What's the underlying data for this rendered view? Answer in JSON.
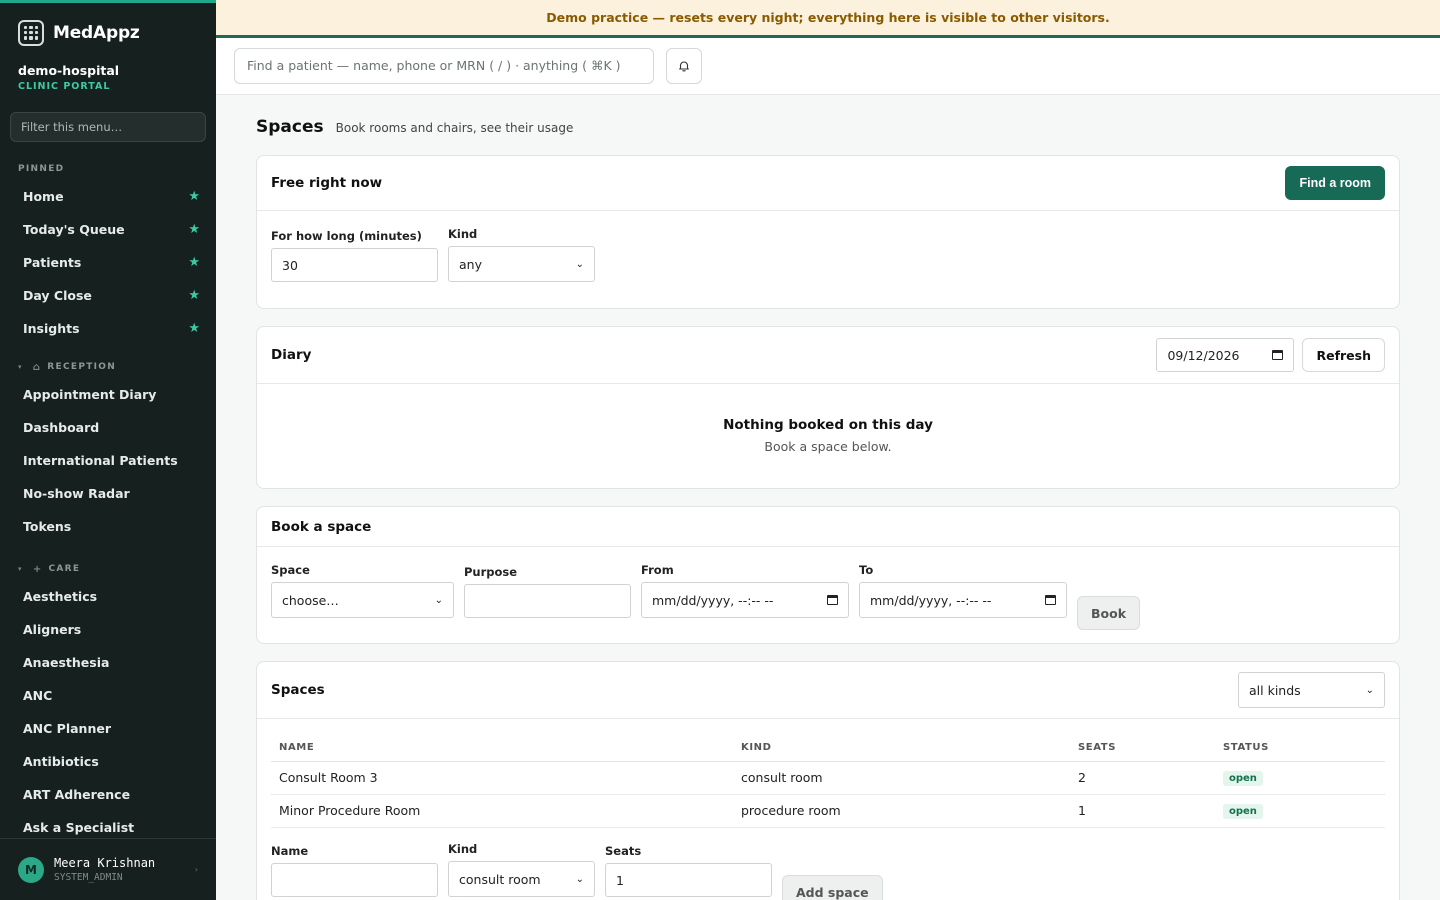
{
  "brand": {
    "name": "MedAppz"
  },
  "org": {
    "name": "demo-hospital",
    "subtitle": "CLINIC PORTAL"
  },
  "sidebar": {
    "filter_placeholder": "Filter this menu…",
    "pinned_label": "PINNED",
    "pinned": [
      {
        "label": "Home"
      },
      {
        "label": "Today's Queue"
      },
      {
        "label": "Patients"
      },
      {
        "label": "Day Close"
      },
      {
        "label": "Insights"
      }
    ],
    "groups": [
      {
        "label": "RECEPTION",
        "icon": "house-icon",
        "items": [
          {
            "label": "Appointment Diary"
          },
          {
            "label": "Dashboard"
          },
          {
            "label": "International Patients"
          },
          {
            "label": "No-show Radar"
          },
          {
            "label": "Tokens"
          }
        ]
      },
      {
        "label": "CARE",
        "icon": "plus-icon",
        "items": [
          {
            "label": "Aesthetics"
          },
          {
            "label": "Aligners"
          },
          {
            "label": "Anaesthesia"
          },
          {
            "label": "ANC"
          },
          {
            "label": "ANC Planner"
          },
          {
            "label": "Antibiotics"
          },
          {
            "label": "ART Adherence"
          },
          {
            "label": "Ask a Specialist"
          }
        ]
      }
    ]
  },
  "user": {
    "initial": "M",
    "name": "Meera Krishnan",
    "role": "SYSTEM_ADMIN"
  },
  "banner": {
    "text": "Demo practice — resets every night; everything here is visible to other visitors."
  },
  "topbar": {
    "search_placeholder": "Find a patient — name, phone or MRN ( / ) · anything ( ⌘K )"
  },
  "page": {
    "title": "Spaces",
    "subtitle": "Book rooms and chairs, see their usage"
  },
  "free_now": {
    "title": "Free right now",
    "button": "Find a room",
    "duration_label": "For how long (minutes)",
    "duration_value": "30",
    "kind_label": "Kind",
    "kind_value": "any"
  },
  "diary": {
    "title": "Diary",
    "date_value": "09/12/2026",
    "refresh_button": "Refresh",
    "empty_title": "Nothing booked on this day",
    "empty_sub": "Book a space below."
  },
  "book": {
    "title": "Book a space",
    "space_label": "Space",
    "space_value": "choose…",
    "purpose_label": "Purpose",
    "purpose_value": "",
    "from_label": "From",
    "from_value": "mm/dd/yyyy, --:-- --",
    "to_label": "To",
    "to_value": "mm/dd/yyyy, --:-- --",
    "button": "Book"
  },
  "spaces": {
    "title": "Spaces",
    "filter_value": "all kinds",
    "columns": [
      "NAME",
      "KIND",
      "SEATS",
      "STATUS"
    ],
    "rows": [
      {
        "name": "Consult Room 3",
        "kind": "consult room",
        "seats": "2",
        "status": "open"
      },
      {
        "name": "Minor Procedure Room",
        "kind": "procedure room",
        "seats": "1",
        "status": "open"
      }
    ],
    "add": {
      "name_label": "Name",
      "name_value": "",
      "kind_label": "Kind",
      "kind_value": "consult room",
      "seats_label": "Seats",
      "seats_value": "1",
      "button": "Add space"
    }
  },
  "colors": {
    "accent": "#166a56",
    "sidebar_bg": "#16201f",
    "star": "#3ec9a4",
    "banner_bg": "#fbf1dc",
    "banner_text": "#8a5a00"
  }
}
